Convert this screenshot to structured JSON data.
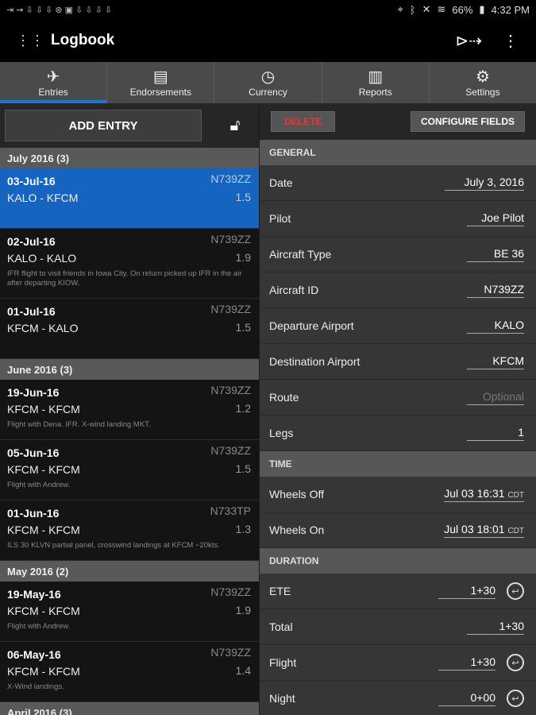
{
  "status": {
    "left_icons": "⇥ ⇝ ⇩ ⇩ ⇩ ⊛ ▣ ⇩ ⇩ ⇩ ⇩",
    "battery": "66%",
    "time": "4:32 PM"
  },
  "appbar": {
    "title": "Logbook"
  },
  "tabs": [
    {
      "label": "Entries",
      "icon": "plane-icon"
    },
    {
      "label": "Endorsements",
      "icon": "certificate-icon"
    },
    {
      "label": "Currency",
      "icon": "clock-icon"
    },
    {
      "label": "Reports",
      "icon": "bar-chart-icon"
    },
    {
      "label": "Settings",
      "icon": "gear-icon"
    }
  ],
  "left": {
    "add_entry": "ADD ENTRY",
    "sections": [
      {
        "title": "July 2016 (3)",
        "entries": [
          {
            "date": "03-Jul-16",
            "tail": "N739ZZ",
            "route": "KALO - KFCM",
            "hours": "1.5",
            "notes": ""
          },
          {
            "date": "02-Jul-16",
            "tail": "N739ZZ",
            "route": "KALO - KALO",
            "hours": "1.9",
            "notes": "IFR flight to visit friends in Iowa City. On return picked up IFR in the air after departing KIOW."
          },
          {
            "date": "01-Jul-16",
            "tail": "N739ZZ",
            "route": "KFCM - KALO",
            "hours": "1.5",
            "notes": ""
          }
        ]
      },
      {
        "title": "June 2016 (3)",
        "entries": [
          {
            "date": "19-Jun-16",
            "tail": "N739ZZ",
            "route": "KFCM - KFCM",
            "hours": "1.2",
            "notes": "Flight with Dena. IFR. X-wind landing MKT."
          },
          {
            "date": "05-Jun-16",
            "tail": "N739ZZ",
            "route": "KFCM - KFCM",
            "hours": "1.5",
            "notes": "Flight with Andrew."
          },
          {
            "date": "01-Jun-16",
            "tail": "N733TP",
            "route": "KFCM - KFCM",
            "hours": "1.3",
            "notes": "ILS 30 KLVN partial panel, crosswind landings at KFCM ~20kts."
          }
        ]
      },
      {
        "title": "May 2016 (2)",
        "entries": [
          {
            "date": "19-May-16",
            "tail": "N739ZZ",
            "route": "KFCM - KFCM",
            "hours": "1.9",
            "notes": "Flight with Andrew."
          },
          {
            "date": "06-May-16",
            "tail": "N739ZZ",
            "route": "KFCM - KFCM",
            "hours": "1.4",
            "notes": "X-Wind landings."
          }
        ]
      },
      {
        "title": "April 2016 (3)",
        "entries": []
      }
    ]
  },
  "right": {
    "delete": "DELETE",
    "configure": "CONFIGURE FIELDS",
    "general": {
      "title": "GENERAL",
      "date_label": "Date",
      "date_value": "July 3, 2016",
      "pilot_label": "Pilot",
      "pilot_value": "Joe Pilot",
      "aircraft_type_label": "Aircraft Type",
      "aircraft_type_value": "BE 36",
      "aircraft_id_label": "Aircraft ID",
      "aircraft_id_value": "N739ZZ",
      "departure_label": "Departure Airport",
      "departure_value": "KALO",
      "destination_label": "Destination Airport",
      "destination_value": "KFCM",
      "route_label": "Route",
      "route_placeholder": "Optional",
      "legs_label": "Legs",
      "legs_value": "1"
    },
    "time": {
      "title": "TIME",
      "wheels_off_label": "Wheels Off",
      "wheels_off_value": "Jul 03 16:31",
      "wheels_off_tz": "CDT",
      "wheels_on_label": "Wheels On",
      "wheels_on_value": "Jul 03 18:01",
      "wheels_on_tz": "CDT"
    },
    "duration": {
      "title": "DURATION",
      "ete_label": "ETE",
      "ete_value": "1+30",
      "total_label": "Total",
      "total_value": "1+30",
      "flight_label": "Flight",
      "flight_value": "1+30",
      "night_label": "Night",
      "night_value": "0+00"
    }
  },
  "colors": {
    "accent": "#1976d2",
    "selected_row": "#1565c0",
    "delete_red": "#e53935"
  }
}
